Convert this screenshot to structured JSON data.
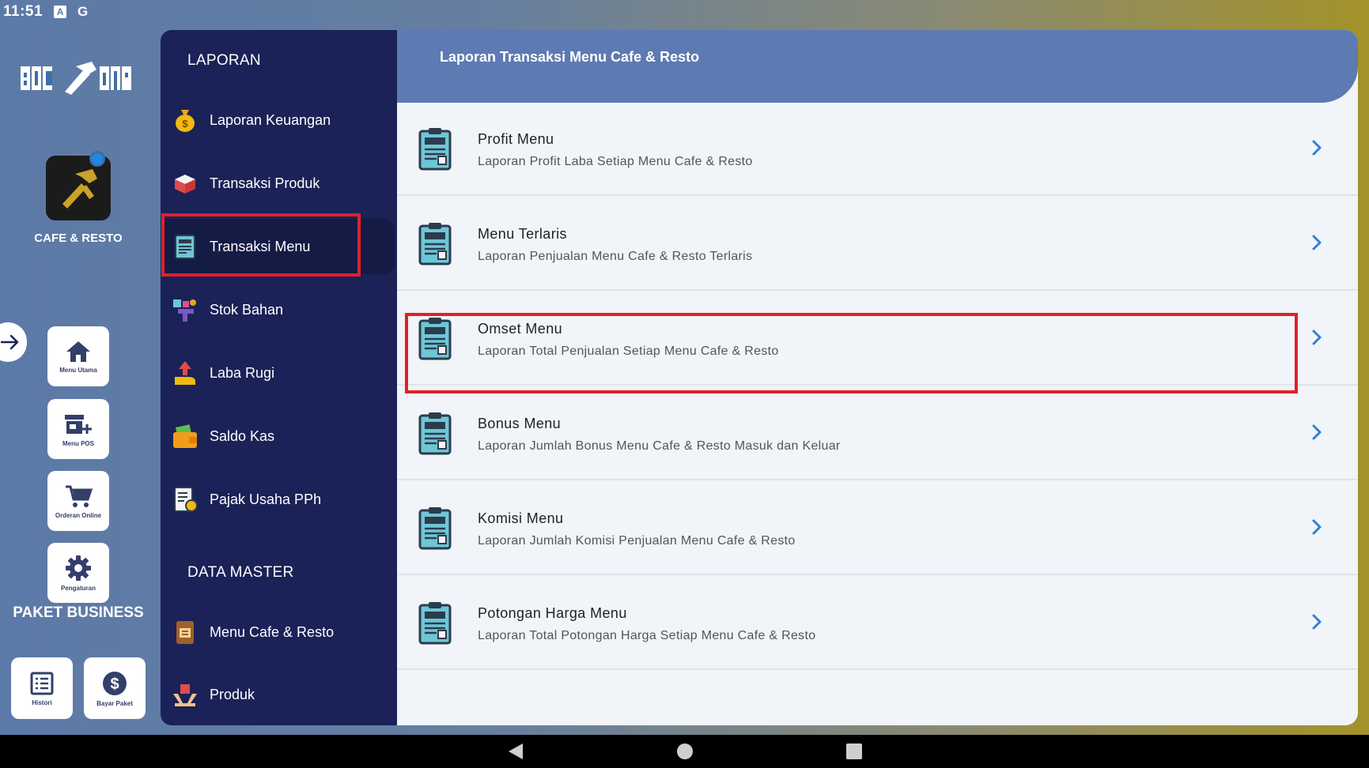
{
  "status_bar": {
    "time": "11:51",
    "icons": [
      "keyboard-a-icon",
      "google-g-icon"
    ],
    "g_label": "G",
    "a_label": "A"
  },
  "rail": {
    "logo_text": "BOC AJA",
    "app_name": "CAFE & RESTO",
    "buttons": [
      {
        "label": "Menu Utama",
        "icon": "home-icon"
      },
      {
        "label": "Menu POS",
        "icon": "store-add-icon"
      },
      {
        "label": "Orderan Online",
        "icon": "cart-icon"
      },
      {
        "label": "Pengaturan",
        "icon": "gear-icon"
      }
    ],
    "paket_title": "PAKET BUSINESS",
    "paket_buttons": [
      {
        "label": "Histori",
        "icon": "list-icon"
      },
      {
        "label": "Bayar Paket",
        "icon": "dollar-icon"
      }
    ]
  },
  "menu": {
    "section_laporan": "LAPORAN",
    "laporan_items": [
      {
        "label": "Laporan Keuangan",
        "icon": "money-bag-icon"
      },
      {
        "label": "Transaksi Produk",
        "icon": "box-icon"
      },
      {
        "label": "Transaksi Menu",
        "icon": "menu-board-icon",
        "active": true
      },
      {
        "label": "Stok Bahan",
        "icon": "ingredients-icon"
      },
      {
        "label": "Laba Rugi",
        "icon": "profit-hand-icon"
      },
      {
        "label": "Saldo Kas",
        "icon": "wallet-icon"
      },
      {
        "label": "Pajak Usaha PPh",
        "icon": "tax-document-icon"
      }
    ],
    "section_master": "DATA MASTER",
    "master_items": [
      {
        "label": "Menu Cafe & Resto",
        "icon": "menu-book-icon"
      },
      {
        "label": "Produk",
        "icon": "product-hands-icon"
      }
    ]
  },
  "content": {
    "title": "Laporan Transaksi Menu Cafe & Resto",
    "rows": [
      {
        "title": "Profit Menu",
        "subtitle": "Laporan Profit Laba Setiap Menu Cafe & Resto"
      },
      {
        "title": "Menu Terlaris",
        "subtitle": "Laporan Penjualan Menu Cafe & Resto Terlaris"
      },
      {
        "title": "Omset Menu",
        "subtitle": "Laporan Total Penjualan Setiap Menu Cafe & Resto"
      },
      {
        "title": "Bonus Menu",
        "subtitle": "Laporan Jumlah Bonus Menu Cafe & Resto Masuk dan Keluar"
      },
      {
        "title": "Komisi Menu",
        "subtitle": "Laporan Jumlah Komisi Penjualan Menu Cafe & Resto"
      },
      {
        "title": "Potongan Harga Menu",
        "subtitle": "Laporan Total Potongan Harga Setiap Menu Cafe & Resto"
      }
    ]
  },
  "colors": {
    "accent": "#1a2257",
    "header": "#5d7ab2",
    "highlight": "#e0202a"
  }
}
